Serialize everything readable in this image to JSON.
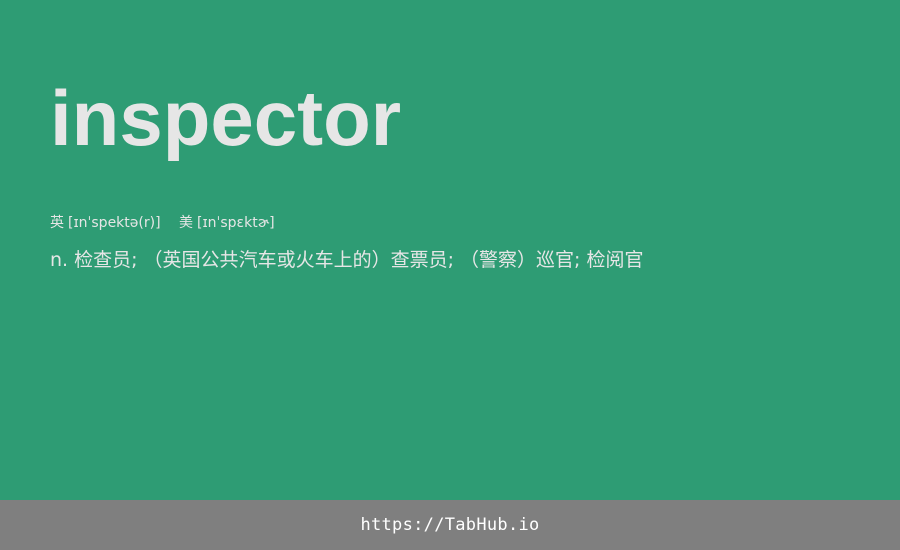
{
  "word": "inspector",
  "phonetics": {
    "uk": {
      "label": "英",
      "ipa": "[ɪnˈspektə(r)]"
    },
    "us": {
      "label": "美",
      "ipa": "[ɪnˈspɛktɚ]"
    }
  },
  "definition": "n. 检查员; （英国公共汽车或火车上的）查票员; （警察）巡官; 检阅官",
  "footer": {
    "link_text": "https://TabHub.io"
  },
  "colors": {
    "background": "#2e9c74",
    "footer": "#7f7f7f",
    "text": "#e6e6e6"
  }
}
